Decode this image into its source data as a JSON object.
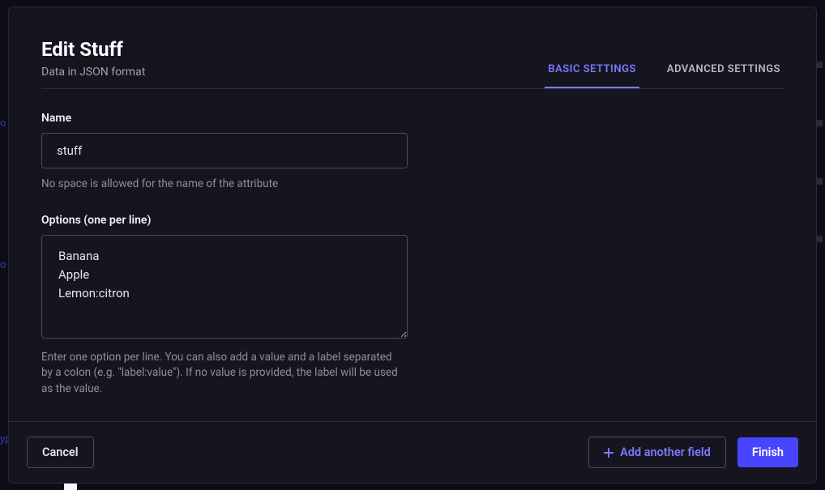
{
  "backdrop": {
    "t1": "o",
    "t2": "o",
    "t3": "yp"
  },
  "header": {
    "title": "Edit Stuff",
    "subtitle": "Data in JSON format"
  },
  "tabs": {
    "basic": "BASIC SETTINGS",
    "advanced": "ADVANCED SETTINGS"
  },
  "form": {
    "name": {
      "label": "Name",
      "value": "stuff",
      "help": "No space is allowed for the name of the attribute"
    },
    "options": {
      "label": "Options (one per line)",
      "value": "Banana\nApple\nLemon:citron",
      "help": "Enter one option per line. You can also add a value and a label separated by a colon (e.g. \"label:value\"). If no value is provided, the label will be used as the value."
    }
  },
  "footer": {
    "cancel": "Cancel",
    "add_another": "Add another field",
    "finish": "Finish"
  }
}
